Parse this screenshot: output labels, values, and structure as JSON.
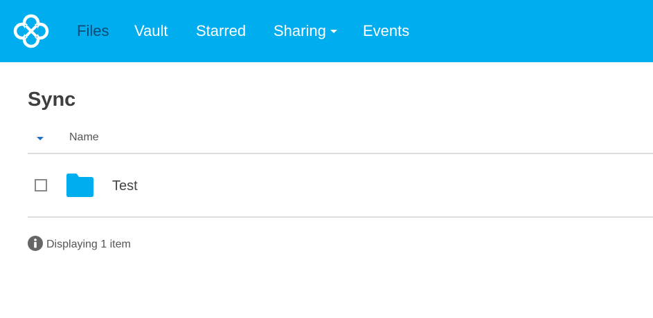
{
  "app": {
    "brand_color": "#00adef",
    "logo_icon": "sync-logo-icon"
  },
  "nav": {
    "items": [
      {
        "label": "Files",
        "active": true
      },
      {
        "label": "Vault",
        "active": false
      },
      {
        "label": "Starred",
        "active": false
      },
      {
        "label": "Sharing",
        "active": false,
        "has_dropdown": true
      },
      {
        "label": "Events",
        "active": false
      }
    ]
  },
  "page": {
    "title": "Sync"
  },
  "table": {
    "sort_icon": "caret-down-icon",
    "columns": [
      "Name"
    ],
    "rows": [
      {
        "name": "Test",
        "type": "folder",
        "icon": "folder-icon",
        "checked": false
      }
    ]
  },
  "status": {
    "icon": "info-icon",
    "text": "Displaying 1 item"
  }
}
